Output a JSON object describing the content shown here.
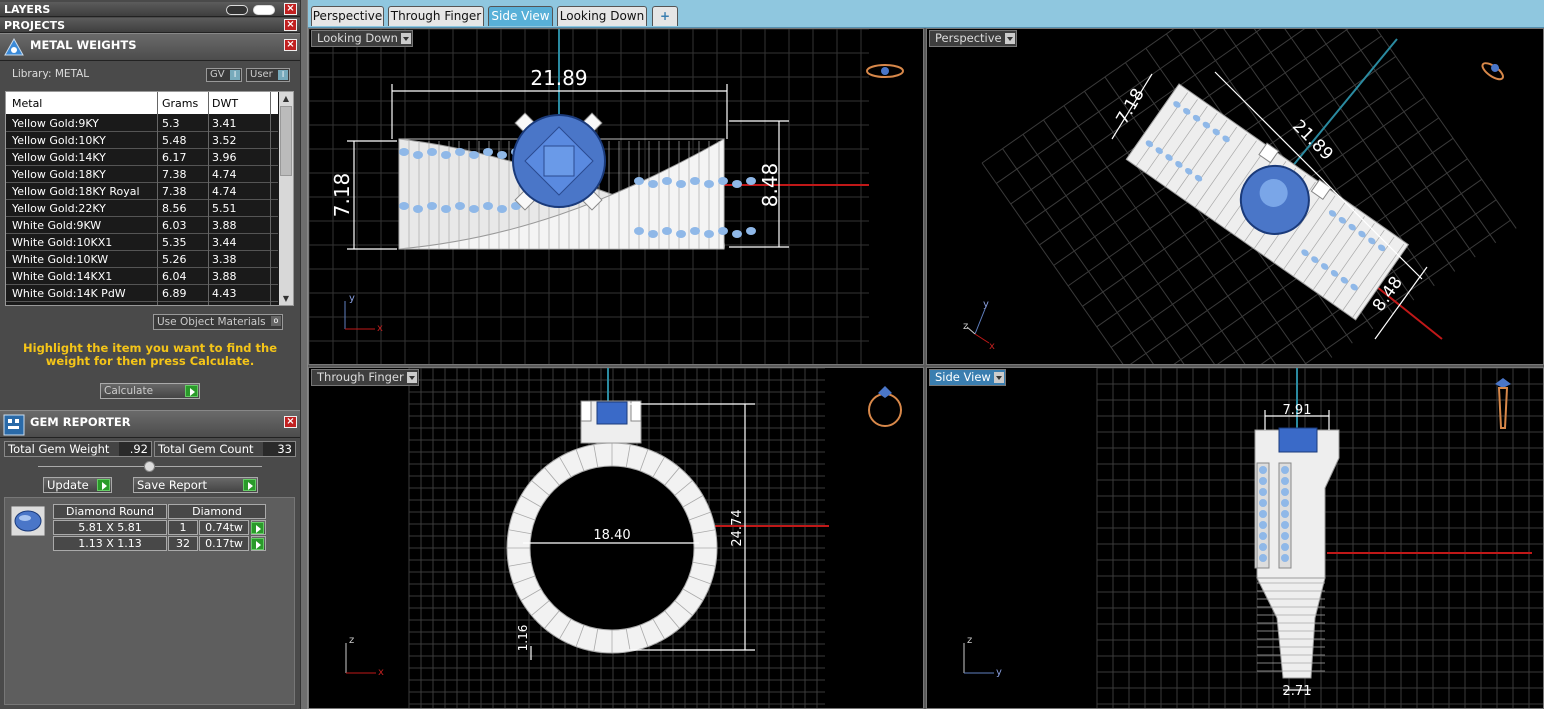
{
  "panels": {
    "layers": "LAYERS",
    "projects": "PROJECTS",
    "metal_weights": "METAL WEIGHTS",
    "gem_reporter": "GEM REPORTER"
  },
  "metal": {
    "library_label": "Library: METAL",
    "toggle_gv": "GV",
    "toggle_user": "User",
    "columns": [
      "Metal",
      "Grams",
      "DWT"
    ],
    "rows": [
      [
        "Yellow Gold:9KY",
        "5.3",
        "3.41"
      ],
      [
        "Yellow Gold:10KY",
        "5.48",
        "3.52"
      ],
      [
        "Yellow Gold:14KY",
        "6.17",
        "3.96"
      ],
      [
        "Yellow Gold:18KY",
        "7.38",
        "4.74"
      ],
      [
        "Yellow Gold:18KY Royal",
        "7.38",
        "4.74"
      ],
      [
        "Yellow Gold:22KY",
        "8.56",
        "5.51"
      ],
      [
        "White Gold:9KW",
        "6.03",
        "3.88"
      ],
      [
        "White Gold:10KX1",
        "5.35",
        "3.44"
      ],
      [
        "White Gold:10KW",
        "5.26",
        "3.38"
      ],
      [
        "White Gold:14KX1",
        "6.04",
        "3.88"
      ],
      [
        "White Gold:14K PdW",
        "6.89",
        "4.43"
      ]
    ],
    "use_object_materials": "Use Object Materials",
    "message": "Highlight the item you want to find the weight for then press Calculate.",
    "calculate": "Calculate"
  },
  "gem": {
    "total_weight_label": "Total Gem Weight",
    "total_weight": ".92",
    "total_count_label": "Total Gem Count",
    "total_count": "33",
    "update": "Update",
    "save_report": "Save Report",
    "header": [
      "Diamond Round",
      "Diamond"
    ],
    "rows": [
      [
        "5.81 X 5.81",
        "1",
        "0.74tw"
      ],
      [
        "1.13 X 1.13",
        "32",
        "0.17tw"
      ]
    ]
  },
  "tabs": [
    "Perspective",
    "Through Finger",
    "Side View",
    "Looking Down",
    "+"
  ],
  "active_tab": "Side View",
  "viewports": {
    "looking_down": {
      "label": "Looking Down",
      "dims": [
        "21.89",
        "7.18",
        "8.48"
      ],
      "axes": [
        "y",
        "x"
      ]
    },
    "perspective": {
      "label": "Perspective",
      "dims": [
        "7.18",
        "21.89",
        "8.48"
      ],
      "axes": [
        "y",
        "z",
        "x"
      ]
    },
    "through_finger": {
      "label": "Through Finger",
      "dims": [
        "18.40",
        "24.74",
        "1.16"
      ],
      "axes": [
        "z",
        "x"
      ]
    },
    "side_view": {
      "label": "Side View",
      "dims": [
        "7.91",
        "2.71"
      ],
      "axes": [
        "z",
        "y"
      ]
    }
  },
  "colors": {
    "gem": "#4a76c8",
    "grid": "#3a3a3a",
    "axis_red": "#c01818",
    "axis_teal": "#2a8aa0",
    "active_tab": "#58b0d8",
    "message": "#f5c518"
  }
}
